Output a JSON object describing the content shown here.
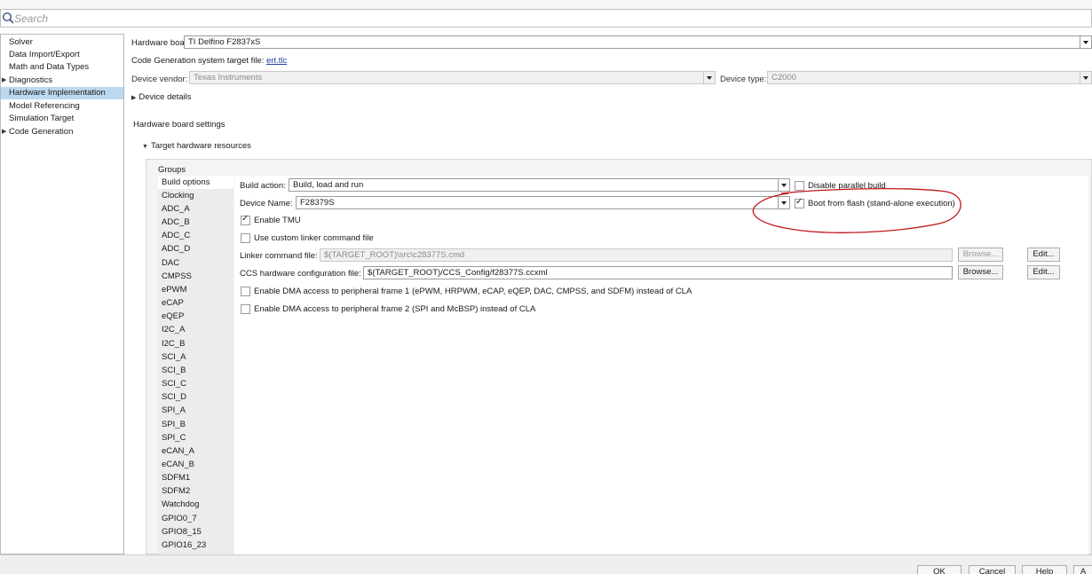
{
  "search": {
    "placeholder": "Search"
  },
  "nav": {
    "items": [
      {
        "label": "Solver",
        "expandable": false
      },
      {
        "label": "Data Import/Export",
        "expandable": false
      },
      {
        "label": "Math and Data Types",
        "expandable": false
      },
      {
        "label": "Diagnostics",
        "expandable": true
      },
      {
        "label": "Hardware Implementation",
        "expandable": false,
        "selected": true
      },
      {
        "label": "Model Referencing",
        "expandable": false
      },
      {
        "label": "Simulation Target",
        "expandable": false
      },
      {
        "label": "Code Generation",
        "expandable": true
      }
    ]
  },
  "main": {
    "hardware_board_label": "Hardware board:",
    "hardware_board_value": "TI Delfino F2837xS",
    "codegen_label": "Code Generation system target file:",
    "codegen_link": "ert.tlc",
    "device_vendor_label": "Device vendor:",
    "device_vendor_value": "Texas Instruments",
    "device_type_label": "Device type:",
    "device_type_value": "C2000",
    "device_details": "Device details",
    "board_settings": "Hardware board settings",
    "target_resources": "Target hardware resources"
  },
  "groups": {
    "label": "Groups",
    "items": [
      "Build options",
      "Clocking",
      "ADC_A",
      "ADC_B",
      "ADC_C",
      "ADC_D",
      "DAC",
      "CMPSS",
      "ePWM",
      "eCAP",
      "eQEP",
      "I2C_A",
      "I2C_B",
      "SCI_A",
      "SCI_B",
      "SCI_C",
      "SCI_D",
      "SPI_A",
      "SPI_B",
      "SPI_C",
      "eCAN_A",
      "eCAN_B",
      "SDFM1",
      "SDFM2",
      "Watchdog",
      "GPIO0_7",
      "GPIO8_15",
      "GPIO16_23"
    ],
    "selected": "Build options"
  },
  "build": {
    "build_action_label": "Build action:",
    "build_action_value": "Build, load and run",
    "disable_parallel": "Disable parallel build",
    "device_name_label": "Device Name:",
    "device_name_value": "F28379S",
    "boot_from_flash": "Boot from flash (stand-alone execution)",
    "enable_tmu": "Enable TMU",
    "custom_linker": "Use custom linker command file",
    "linker_label": "Linker command file:",
    "linker_value": "$(TARGET_ROOT)\\src\\c28377S.cmd",
    "ccs_label": "CCS hardware configuration file:",
    "ccs_value": "$(TARGET_ROOT)/CCS_Config/f28377S.ccxml",
    "browse": "Browse...",
    "edit": "Edit...",
    "dma1": "Enable DMA access to peripheral frame 1 (ePWM, HRPWM, eCAP, eQEP, DAC, CMPSS, and SDFM) instead of CLA",
    "dma2": "Enable DMA access to peripheral frame 2 (SPI and McBSP) instead of CLA",
    "checks": {
      "disable_parallel": false,
      "boot_from_flash": true,
      "enable_tmu": true,
      "custom_linker": false,
      "dma1": false,
      "dma2": false
    }
  },
  "footer": {
    "ok": "OK",
    "cancel": "Cancel",
    "help": "Help",
    "apply": "A"
  },
  "colors": {
    "selection": "#bcd8ef",
    "annotation": "#c0171c",
    "link": "#1a3fa8"
  }
}
